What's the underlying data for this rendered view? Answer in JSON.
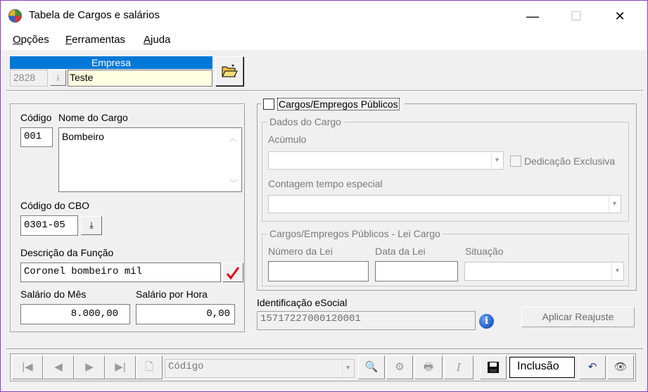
{
  "window": {
    "title": "Tabela de Cargos e salários",
    "minimize": "—",
    "maximize": "☐",
    "close": "✕"
  },
  "menu": [
    {
      "key": "O",
      "rest": "pções"
    },
    {
      "key": "F",
      "rest": "erramentas"
    },
    {
      "key": "A",
      "rest": "juda"
    }
  ],
  "empresa": {
    "header": "Empresa",
    "code": "2828",
    "name": "Teste"
  },
  "cargo": {
    "codigo_label": "Código",
    "codigo": "001",
    "nome_label": "Nome do Cargo",
    "nome": "Bombeiro",
    "cbo_label": "Código do CBO",
    "cbo": "0301-05",
    "descricao_label": "Descrição da Função",
    "descricao": "Coronel bombeiro mil",
    "salario_mes_label": "Salário do Mês",
    "salario_mes": "8.000,00",
    "salario_hora_label": "Salário por Hora",
    "salario_hora": "0,00"
  },
  "publicos": {
    "checkbox_label": "Cargos/Empregos Públicos",
    "dados_title": "Dados do Cargo",
    "acumulo_label": "Acúmulo",
    "acumulo_value": "",
    "dedicacao_label": "Dedicação Exclusiva",
    "contagem_label": "Contagem tempo especial",
    "contagem_value": "",
    "lei_title": "Cargos/Empregos Públicos - Lei Cargo",
    "numero_lei_label": "Número da Lei",
    "data_lei_label": "Data da Lei",
    "situacao_label": "Situação"
  },
  "esocial": {
    "label": "Identificação eSocial",
    "value": "15717227000120001"
  },
  "aplicar_reajuste": "Aplicar Reajuste",
  "toolbar": {
    "search_value": "Código",
    "mode": "Inclusão"
  },
  "colors": {
    "header_blue": "#0078d7",
    "yellow_field": "#ffffe1",
    "check_red": "#e0001a",
    "info_blue": "#1e5bc6"
  }
}
